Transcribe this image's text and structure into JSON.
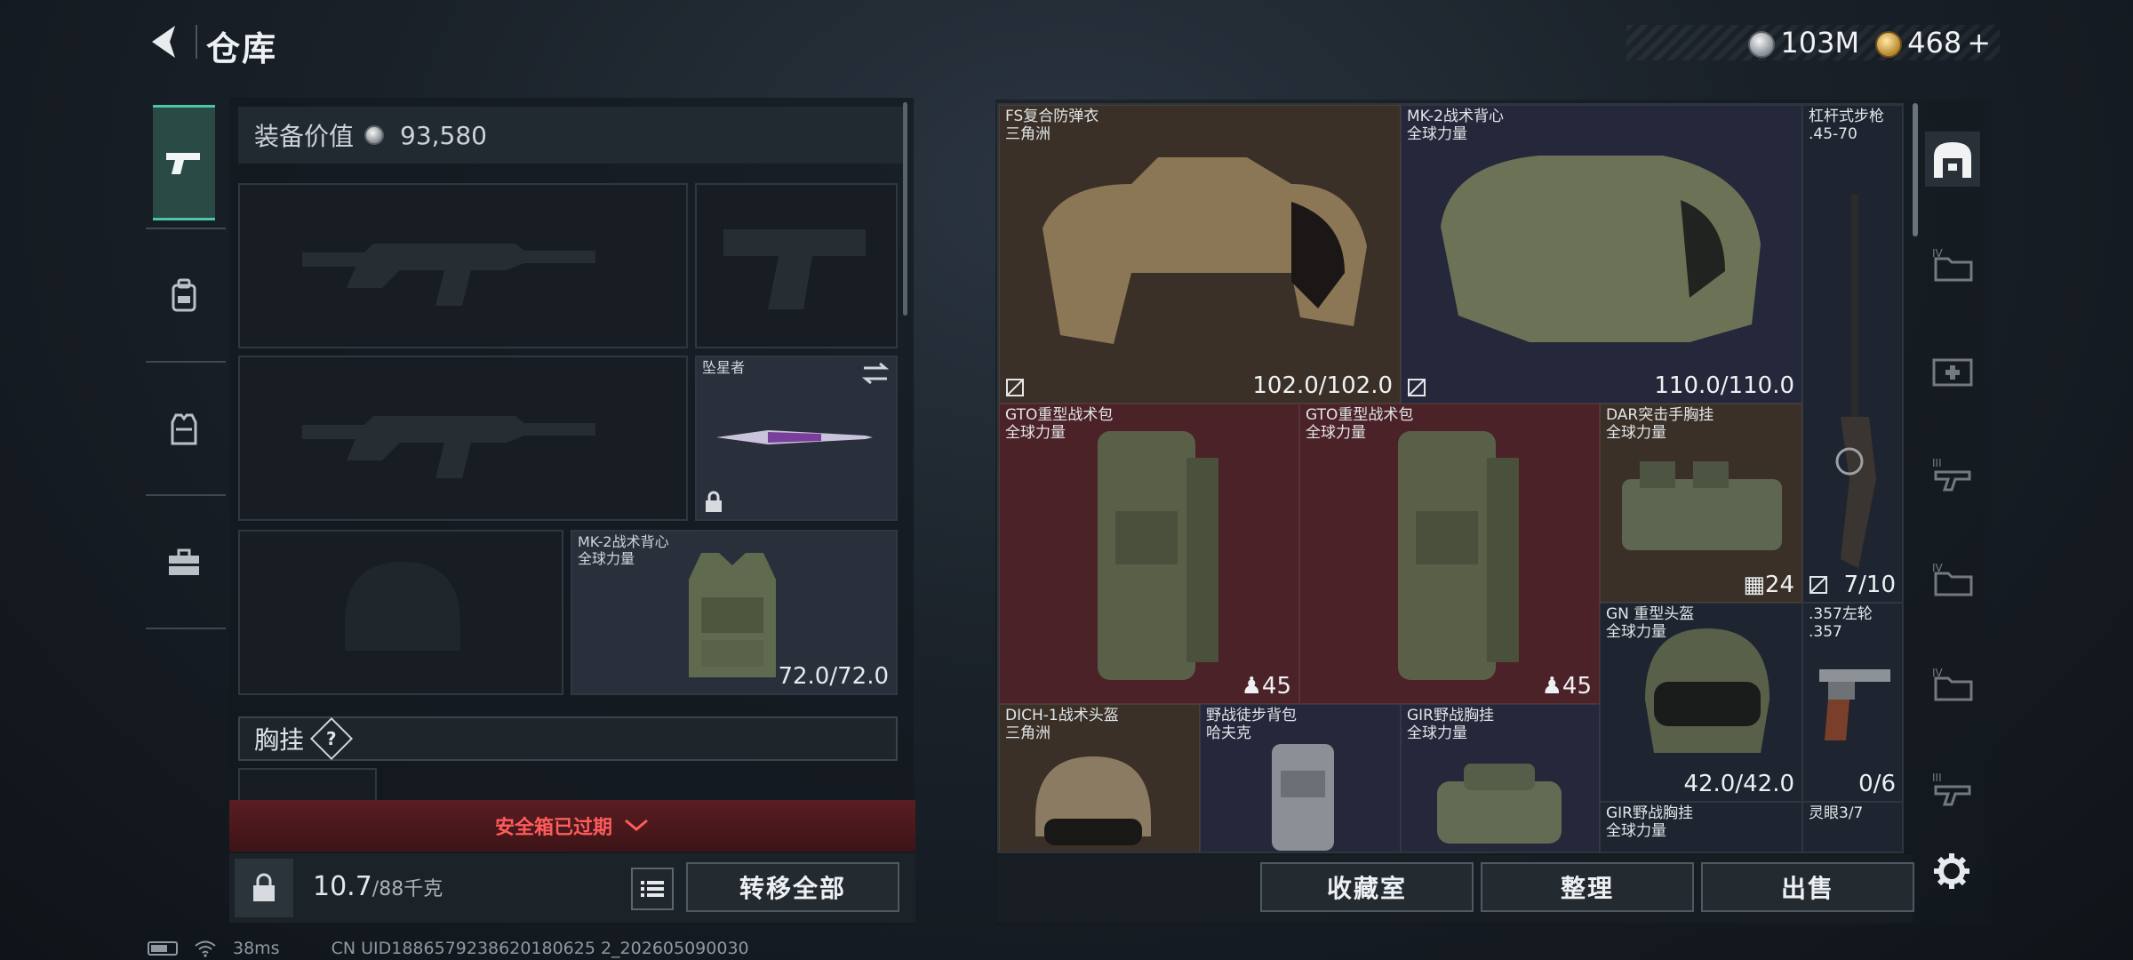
{
  "header": {
    "title": "仓库",
    "currency": [
      {
        "icon": "silver-coin-icon",
        "amount": "103M"
      },
      {
        "icon": "gold-coin-icon",
        "amount": "468"
      }
    ],
    "add_label": "+"
  },
  "left_tabs": [
    {
      "icon": "pistol-icon",
      "active": true
    },
    {
      "icon": "backpack-icon",
      "active": false
    },
    {
      "icon": "vest-icon",
      "active": false
    },
    {
      "icon": "briefcase-icon",
      "active": false
    }
  ],
  "equipment": {
    "value_label": "装备价值",
    "value": "93,580",
    "melee_name": "坠星者",
    "vest_name": "MK-2战术背心",
    "vest_sub": "全球力量",
    "vest_durability": "72.0/72.0",
    "chest_label": "胸挂",
    "chest_help": "?",
    "safe_box_expired": "安全箱已过期",
    "weight_value": "10.7",
    "weight_max": "/88千克",
    "transfer_all": "转移全部"
  },
  "inventory": {
    "items": [
      {
        "id": "fs-armor",
        "name": "FS复合防弹衣",
        "sub": "三角洲",
        "value": "102.0/102.0"
      },
      {
        "id": "mk2-vest",
        "name": "MK-2战术背心",
        "sub": "全球力量",
        "value": "110.0/110.0"
      },
      {
        "id": "lever-rifle",
        "name": "杠杆式步枪",
        "sub": ".45-70",
        "value": "7/10"
      },
      {
        "id": "gto-bag-1",
        "name": "GTO重型战术包",
        "sub": "全球力量",
        "value": "45"
      },
      {
        "id": "gto-bag-2",
        "name": "GTO重型战术包",
        "sub": "全球力量",
        "value": "45"
      },
      {
        "id": "dar-rig",
        "name": "DAR突击手胸挂",
        "sub": "全球力量",
        "value": "24"
      },
      {
        "id": "dich-helmet",
        "name": "DICH-1战术头盔",
        "sub": "三角洲",
        "value": ""
      },
      {
        "id": "field-bag",
        "name": "野战徒步背包",
        "sub": "哈夫克",
        "value": ""
      },
      {
        "id": "gir-rig",
        "name": "GIR野战胸挂",
        "sub": "全球力量",
        "value": ""
      },
      {
        "id": "gn-helmet",
        "name": "GN 重型头盔",
        "sub": "全球力量",
        "value": "42.0/42.0"
      },
      {
        "id": "revolver",
        "name": ".357左轮",
        "sub": ".357",
        "value": "0/6"
      },
      {
        "id": "gir-rig-2",
        "name": "GIR野战胸挂",
        "sub": "全球力量",
        "value": ""
      },
      {
        "id": "spirit-eye",
        "name": "灵眼3/7",
        "sub": "",
        "value": ""
      }
    ]
  },
  "actions": {
    "storage": "收藏室",
    "sort": "整理",
    "sell": "出售"
  },
  "status": {
    "ping": "38ms",
    "uid": "CN UID1886579238620180625 2_202605090030"
  }
}
